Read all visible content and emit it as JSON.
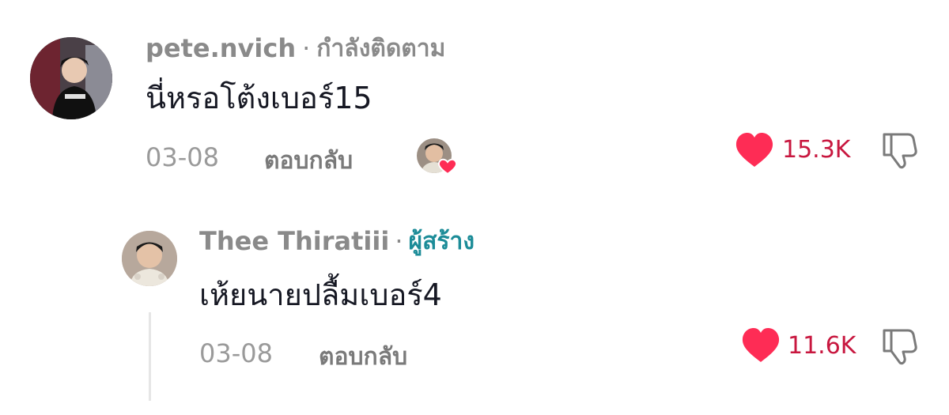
{
  "colors": {
    "username": "#8a8a8a",
    "creator_badge": "#1c8c98",
    "like_heart": "#fe2c55",
    "like_count": "#c8173f",
    "comment_text": "#161823"
  },
  "comments": [
    {
      "username": "pete.nvich",
      "separator": "·",
      "status": "กำลังติดตาม",
      "text": "นี่หรอโต้งเบอร์15",
      "date": "03-08",
      "reply_label": "ตอบกลับ",
      "like_count": "15.3K",
      "liked_by_creator": true,
      "icons": [
        "avatar",
        "heart-icon",
        "dislike-icon",
        "creator-liked-heart-icon"
      ]
    },
    {
      "username": "Thee Thiratiii",
      "separator": "·",
      "status": "ผู้สร้าง",
      "text": "เห้ยนายปลื้มเบอร์4",
      "date": "03-08",
      "reply_label": "ตอบกลับ",
      "like_count": "11.6K",
      "icons": [
        "avatar",
        "heart-icon",
        "dislike-icon"
      ]
    }
  ]
}
